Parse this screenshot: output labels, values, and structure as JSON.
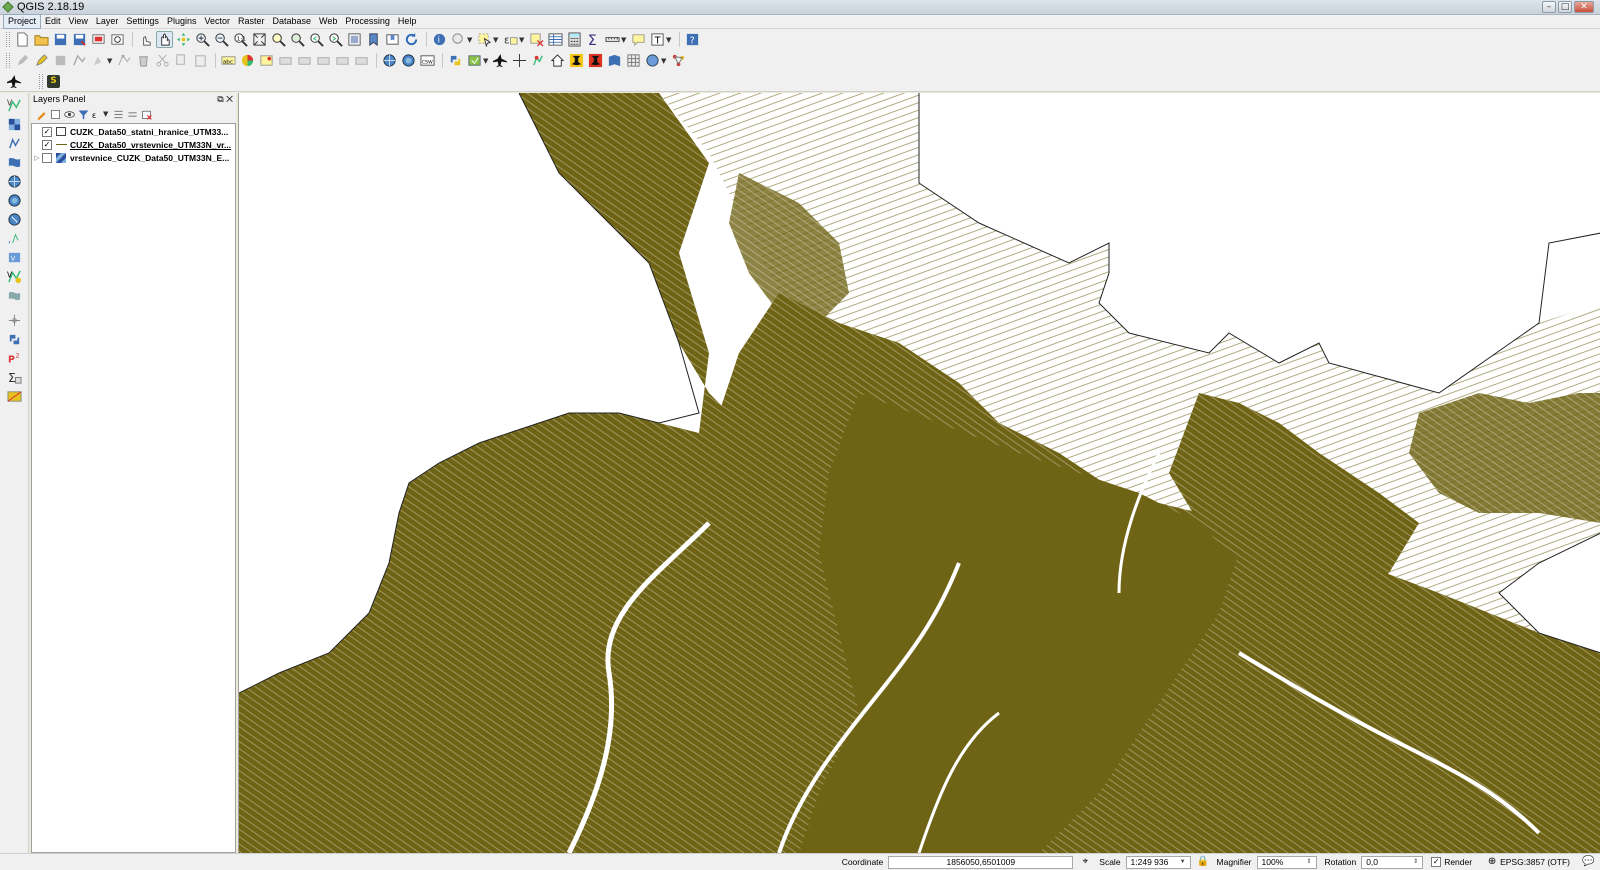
{
  "window": {
    "title": "QGIS 2.18.19"
  },
  "menu": [
    "Project",
    "Edit",
    "View",
    "Layer",
    "Settings",
    "Plugins",
    "Vector",
    "Raster",
    "Database",
    "Web",
    "Processing",
    "Help"
  ],
  "layers_panel": {
    "title": "Layers Panel",
    "layers": [
      {
        "name": "CUZK_Data50_statni_hranice_UTM33...",
        "checked": true,
        "symbol": "polygon",
        "style": "semibold"
      },
      {
        "name": "CUZK_Data50_vrstevnice_UTM33N_vr...",
        "checked": true,
        "symbol": "line",
        "style": "bold"
      },
      {
        "name": "vrstevnice_CUZK_Data50_UTM33N_E...",
        "checked": false,
        "symbol": "raster",
        "style": "semibold"
      }
    ]
  },
  "toolbar3": {
    "s_label": "S"
  },
  "status": {
    "coordinate_label": "Coordinate",
    "coordinate_value": "1856050,6501009",
    "scale_label": "Scale",
    "scale_value": "1:249 936",
    "magnifier_label": "Magnifier",
    "magnifier_value": "100%",
    "rotation_label": "Rotation",
    "rotation_value": "0,0",
    "render_label": "Render",
    "render_checked": true,
    "crs_label": "EPSG:3857 (OTF)"
  },
  "colors": {
    "contour": "#6e6414",
    "contour_dense": "#6f6415"
  }
}
